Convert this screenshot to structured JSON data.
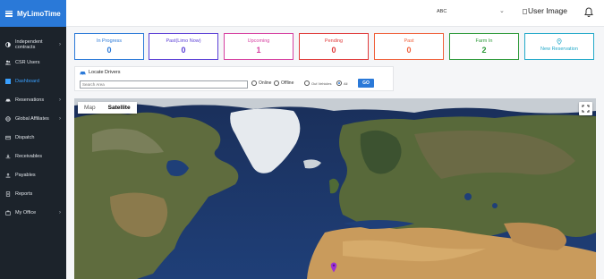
{
  "brand": {
    "name": "MyLimoTime"
  },
  "sidebar": {
    "items": [
      {
        "label": "Independent contracts",
        "icon": "circle-half-icon",
        "has_children": true
      },
      {
        "label": "CSR Users",
        "icon": "users-icon",
        "has_children": false
      },
      {
        "label": "Dashboard",
        "icon": "dashboard-icon",
        "has_children": false,
        "active": true
      },
      {
        "label": "Reservations",
        "icon": "car-icon",
        "has_children": true
      },
      {
        "label": "Global Affiliates",
        "icon": "globe-icon",
        "has_children": true
      },
      {
        "label": "Dispatch",
        "icon": "dispatch-icon",
        "has_children": false
      },
      {
        "label": "Receivables",
        "icon": "download-icon",
        "has_children": false
      },
      {
        "label": "Payables",
        "icon": "upload-icon",
        "has_children": false
      },
      {
        "label": "Reports",
        "icon": "report-icon",
        "has_children": false
      },
      {
        "label": "My Office",
        "icon": "briefcase-icon",
        "has_children": true
      }
    ],
    "chevron": "›"
  },
  "topbar": {
    "company": "ABC",
    "company_chevron": "⌄",
    "user_image_alt": "User Image",
    "bell_icon": "bell-icon"
  },
  "stats": [
    {
      "title": "In Progress",
      "value": "0",
      "color": "#2a79d8"
    },
    {
      "title": "Past(Limo Now)",
      "value": "0",
      "color": "#5b3fd6"
    },
    {
      "title": "Upcoming",
      "value": "1",
      "color": "#d63fa0"
    },
    {
      "title": "Pending",
      "value": "0",
      "color": "#e03b3b"
    },
    {
      "title": "Past",
      "value": "0",
      "color": "#f0603b"
    },
    {
      "title": "Farm In",
      "value": "2",
      "color": "#2e9a3a"
    },
    {
      "title": "New Reservation",
      "value": "",
      "color": "#23a9c9",
      "icon": "map-pin-icon"
    }
  ],
  "locate": {
    "title": "Locate Drivers",
    "search_placeholder": "Search Area",
    "options": [
      {
        "label": "Online",
        "selected": false
      },
      {
        "label": "Offline",
        "selected": false
      },
      {
        "label": "Out Vehicles",
        "selected": false
      },
      {
        "label": "All",
        "selected": true
      }
    ],
    "go_label": "GO"
  },
  "map": {
    "tabs": [
      {
        "label": "Map",
        "active": false
      },
      {
        "label": "Satellite",
        "active": true
      }
    ],
    "fullscreen_icon": "fullscreen-icon",
    "marker_color": "#9b2fd6"
  }
}
